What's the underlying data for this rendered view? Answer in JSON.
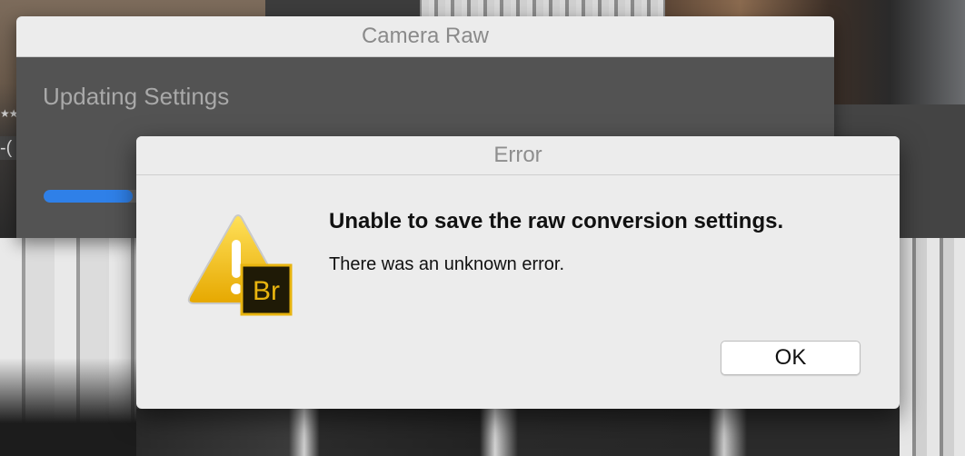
{
  "camera_raw_window": {
    "title": "Camera Raw",
    "heading": "Updating Settings",
    "progress": 0.12
  },
  "background": {
    "side_fragment": "-("
  },
  "error_dialog": {
    "title": "Error",
    "icon": "warning-triangle-with-bridge-badge-icon",
    "badge_text": "Br",
    "heading": "Unable to save the raw conversion settings.",
    "message": "There was an unknown error.",
    "ok_label": "OK"
  },
  "colors": {
    "progress_fill": "#2f80e8",
    "warning_yellow": "#f2c30f",
    "bridge_badge_bg": "#1f1a06",
    "bridge_badge_text": "#e8b40f"
  }
}
